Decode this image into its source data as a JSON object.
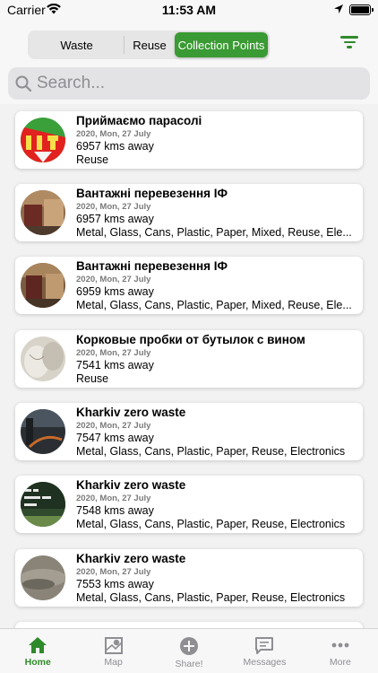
{
  "status": {
    "carrier": "Carrier",
    "time": "11:53 AM"
  },
  "segments": [
    {
      "label": "Waste"
    },
    {
      "label": "Reuse"
    },
    {
      "label": "Collection Points",
      "selected": true
    }
  ],
  "search": {
    "placeholder": "Search...",
    "value": ""
  },
  "items": [
    {
      "title": "Приймаємо парасолі",
      "date": "2020, Mon, 27 July",
      "distance": "6957 kms away",
      "categories": "Reuse"
    },
    {
      "title": "Вантажні перевезення ІФ",
      "date": "2020, Mon, 27 July",
      "distance": "6957 kms away",
      "categories": "Metal, Glass, Cans, Plastic, Paper, Mixed, Reuse, Ele..."
    },
    {
      "title": "Вантажні перевезення ІФ",
      "date": "2020, Mon, 27 July",
      "distance": "6959 kms away",
      "categories": "Metal, Glass, Cans, Plastic, Paper, Mixed, Reuse, Ele..."
    },
    {
      "title": "Корковые пробки от бутылок с вином",
      "date": "2020, Mon, 27 July",
      "distance": "7541 kms away",
      "categories": "Reuse"
    },
    {
      "title": "Kharkiv zero waste",
      "date": "2020, Mon, 27 July",
      "distance": "7547 kms away",
      "categories": "Metal, Glass, Cans, Plastic, Paper, Reuse, Electronics"
    },
    {
      "title": "Kharkiv zero waste",
      "date": "2020, Mon, 27 July",
      "distance": "7548 kms away",
      "categories": "Metal, Glass, Cans, Plastic, Paper, Reuse, Electronics"
    },
    {
      "title": "Kharkiv zero waste",
      "date": "2020, Mon, 27 July",
      "distance": "7553 kms away",
      "categories": "Metal, Glass, Cans, Plastic, Paper, Reuse, Electronics"
    }
  ],
  "tabs": [
    {
      "label": "Home",
      "icon": "home-icon",
      "active": true
    },
    {
      "label": "Map",
      "icon": "map-icon"
    },
    {
      "label": "Share!",
      "icon": "add-circle-icon"
    },
    {
      "label": "Messages",
      "icon": "message-icon"
    },
    {
      "label": "More",
      "icon": "more-icon"
    }
  ],
  "colors": {
    "accent": "#3a9a33",
    "accent_dark": "#2f8a2b",
    "inactive": "#8e8e93"
  }
}
